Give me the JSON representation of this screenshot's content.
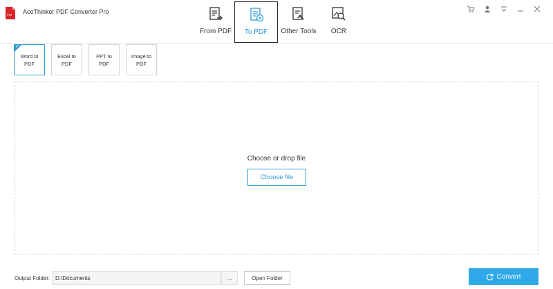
{
  "app": {
    "title": "AceThinker PDF Converter Pro",
    "accent": "#2f9bd6",
    "convert_bg": "#2ea8e8"
  },
  "window_controls": [
    {
      "name": "cart-icon"
    },
    {
      "name": "account-icon"
    },
    {
      "name": "menu-dropdown-icon"
    },
    {
      "name": "minimize-icon"
    },
    {
      "name": "close-icon"
    }
  ],
  "tabs": [
    {
      "label": "From PDF",
      "icon": "from-pdf-icon",
      "active": false
    },
    {
      "label": "To PDF",
      "icon": "to-pdf-icon",
      "active": true
    },
    {
      "label": "Other Tools",
      "icon": "other-tools-icon",
      "active": false
    },
    {
      "label": "OCR",
      "icon": "ocr-icon",
      "active": false
    }
  ],
  "subtabs": [
    {
      "label": "Word to PDF",
      "active": true
    },
    {
      "label": "Excel to PDF",
      "active": false
    },
    {
      "label": "PPT to PDF",
      "active": false
    },
    {
      "label": "Image to PDF",
      "active": false
    }
  ],
  "dropzone": {
    "text": "Choose or drop file",
    "button": "Choose file"
  },
  "output": {
    "label": "Output Folder:",
    "value": "D:\\Documents",
    "browse": "...",
    "open_folder": "Open Folder"
  },
  "convert": {
    "label": "Convert"
  }
}
